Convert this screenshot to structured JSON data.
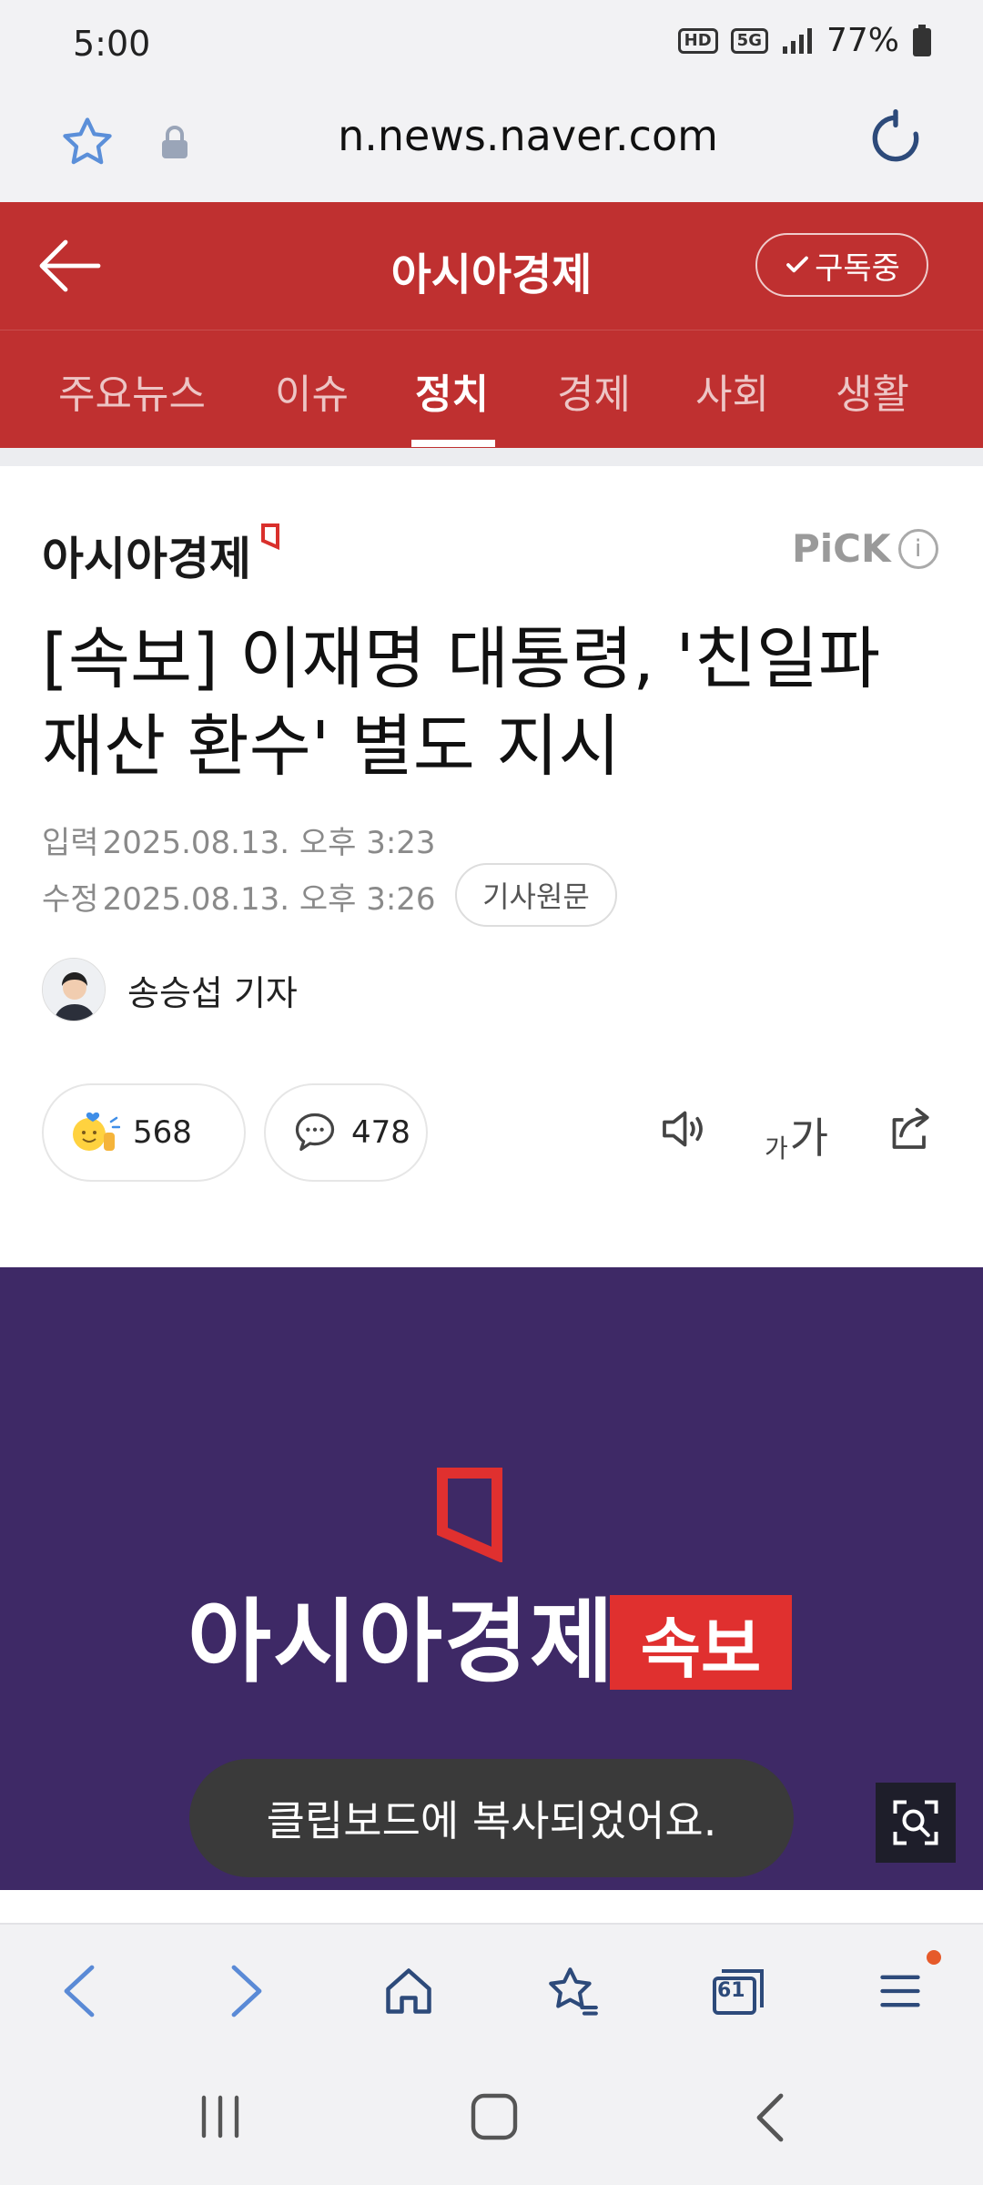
{
  "status": {
    "time": "5:00",
    "signal_label": "5G",
    "hd_label": "HD",
    "battery": "77%"
  },
  "browser": {
    "url": "n.news.naver.com"
  },
  "header": {
    "site_title": "아시아경제",
    "subscribe_label": "구독중",
    "tabs": [
      {
        "label": "주요뉴스",
        "active": false
      },
      {
        "label": "이슈",
        "active": false
      },
      {
        "label": "정치",
        "active": true
      },
      {
        "label": "경제",
        "active": false
      },
      {
        "label": "사회",
        "active": false
      },
      {
        "label": "생활",
        "active": false
      }
    ]
  },
  "article": {
    "press_name": "아시아경제",
    "pick_label": "PiCK",
    "pick_info": "i",
    "headline": "[속보] 이재명 대통령, '친일파 재산 환수' 별도 지시",
    "input_label": "입력",
    "input_date": "2025.08.13. 오후 3:23",
    "modified_label": "수정",
    "modified_date": "2025.08.13. 오후 3:26",
    "original_button": "기사원문",
    "reporter": "송승섭 기자",
    "reaction_count": "568",
    "comment_count": "478",
    "font_size_small": "가",
    "font_size_large": "가"
  },
  "banner": {
    "brand_text": "아시아경제",
    "badge_text": "속보",
    "toast": "클립보드에 복사되었어요."
  },
  "toolbar": {
    "tab_count": "61"
  },
  "colors": {
    "brand_red": "#bf3030",
    "banner_purple": "#3e2966",
    "badge_red": "#e0302f"
  }
}
